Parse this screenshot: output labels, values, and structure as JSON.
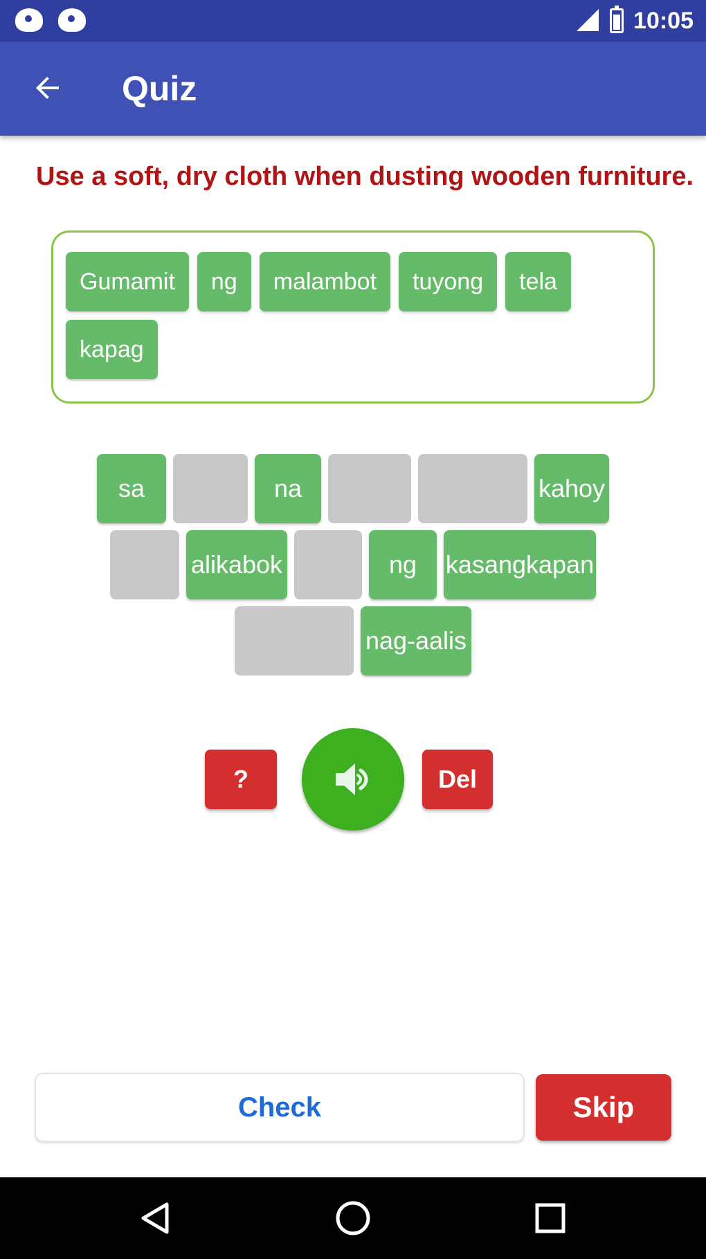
{
  "status_bar": {
    "time": "10:05",
    "icons": [
      "notification-icon",
      "notification-icon",
      "signal-icon",
      "battery-icon"
    ]
  },
  "app_bar": {
    "back_icon": "arrow-left-icon",
    "title": "Quiz"
  },
  "prompt": "Use a soft, dry cloth when dusting wooden furniture.",
  "answer_words": [
    "Gumamit",
    "ng",
    "malambot",
    "tuyong",
    "tela",
    "kapag"
  ],
  "word_bank": {
    "row1": [
      {
        "text": "sa",
        "used": false
      },
      {
        "text": "",
        "used": true
      },
      {
        "text": "na",
        "used": false
      },
      {
        "text": "",
        "used": true
      },
      {
        "text": "",
        "used": true
      },
      {
        "text": "kahoy",
        "used": false
      }
    ],
    "row2": [
      {
        "text": "",
        "used": true
      },
      {
        "text": "alikabok",
        "used": false
      },
      {
        "text": "",
        "used": true
      },
      {
        "text": "ng",
        "used": false
      },
      {
        "text": "kasangkapan",
        "used": false
      }
    ],
    "row3": [
      {
        "text": "",
        "used": true
      },
      {
        "text": "nag-aalis",
        "used": false
      }
    ]
  },
  "controls": {
    "hint_label": "?",
    "speak_icon": "speaker-icon",
    "delete_label": "Del"
  },
  "actions": {
    "check_label": "Check",
    "skip_label": "Skip"
  },
  "colors": {
    "primary": "#3f51b5",
    "primary_dark": "#303f9f",
    "prompt_text": "#b01414",
    "chip_green": "#66bb6a",
    "answer_border": "#8bc34a",
    "empty_tile": "#c8c8c8",
    "danger_red": "#d32f2f",
    "speak_green": "#3cb01f",
    "check_text": "#1e6bd6"
  }
}
